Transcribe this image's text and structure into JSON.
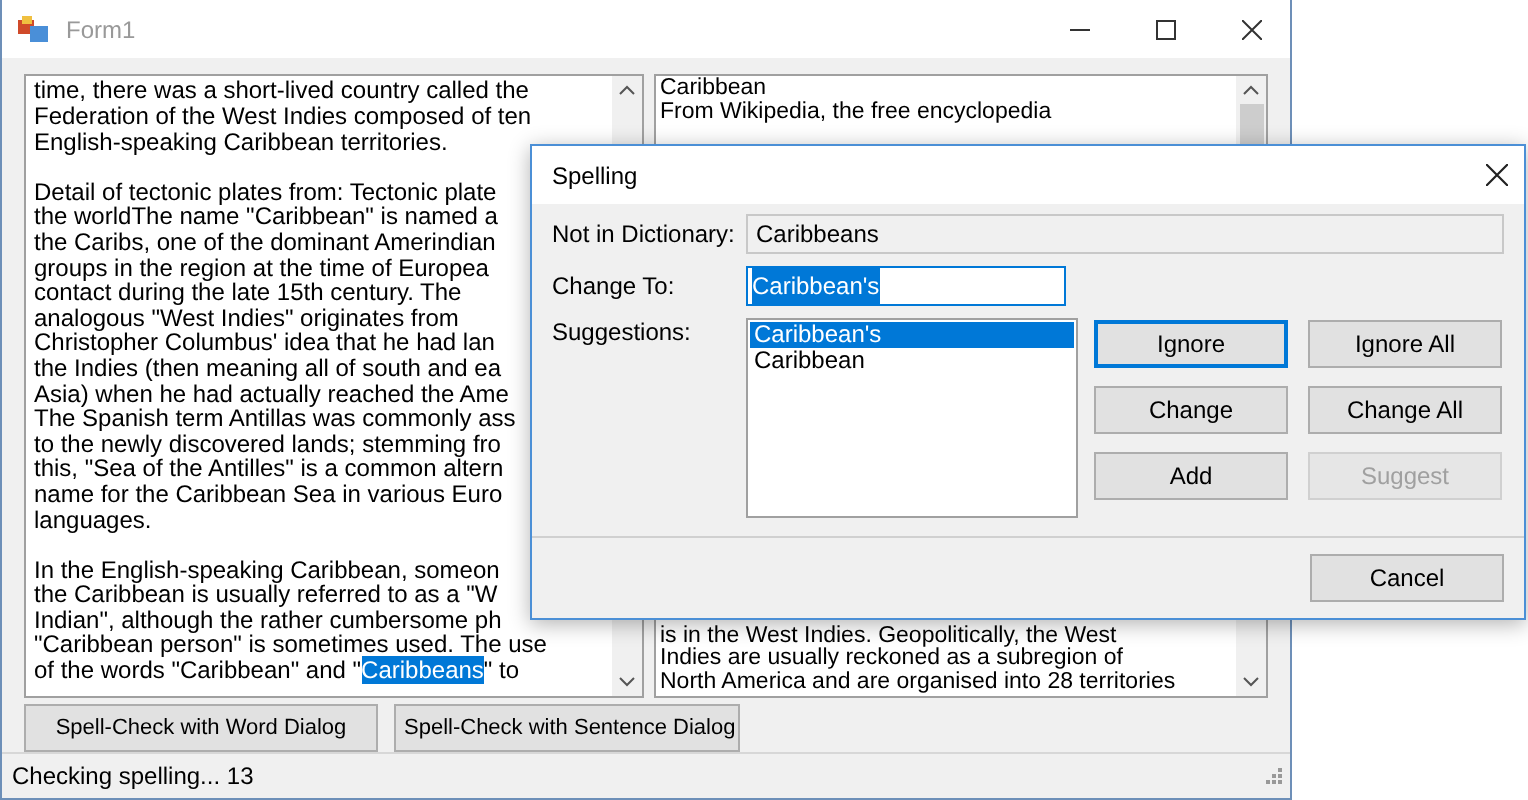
{
  "window": {
    "title": "Form1"
  },
  "left_text": {
    "paragraphs": [
      {
        "lines": [
          "time, there was a short-lived country called the",
          "Federation of the West Indies composed of ten",
          "English-speaking Caribbean territories."
        ]
      },
      {
        "lines": [
          "Detail of tectonic plates from: Tectonic plate",
          "the worldThe name \"Caribbean\" is named a",
          "the Caribs, one of the dominant Amerindian",
          "groups in the region at the time of Europea",
          "contact during the late 15th century. The",
          "analogous \"West Indies\" originates from",
          "Christopher Columbus' idea that he had lan",
          "the Indies (then meaning all of south and ea",
          "Asia) when he had actually reached the Ame",
          "The Spanish term Antillas was commonly ass",
          "to the newly discovered lands; stemming fro",
          "this, \"Sea of the Antilles\" is a common altern",
          "name for the Caribbean Sea in various Euro",
          "languages."
        ]
      },
      {
        "lines": [
          "In the English-speaking Caribbean, someon",
          "the Caribbean is usually referred to as a \"W",
          "Indian\", although the rather cumbersome ph",
          "\"Caribbean person\" is sometimes used. The use",
          [
            {
              "text": "of the words \"Caribbean\" and \"",
              "selected": false
            },
            {
              "text": "Caribbeans",
              "selected": true
            },
            {
              "text": "\" to",
              "selected": false
            }
          ]
        ]
      }
    ]
  },
  "right_text": {
    "top_lines": [
      "Caribbean",
      "From Wikipedia, the free encyclopedia"
    ],
    "bottom_lines": [
      "is in the West Indies. Geopolitically, the West",
      "Indies are usually reckoned as a subregion of",
      "North America and are organised into 28 territories"
    ]
  },
  "buttons": [
    {
      "label": "Spell-Check with Word Dialog"
    },
    {
      "label": "Spell-Check with Sentence Dialog"
    }
  ],
  "status_bar": {
    "text": "Checking spelling... 13"
  },
  "dialog": {
    "title": "Spelling",
    "not_in_dictionary": {
      "label": "Not in Dictionary:",
      "value": "Caribbeans"
    },
    "change_to": {
      "label": "Change To:",
      "value": "Caribbean's",
      "selected": true
    },
    "suggestions": {
      "label": "Suggestions:",
      "items": [
        {
          "text": "Caribbean's",
          "selected": true
        },
        {
          "text": "Caribbean",
          "selected": false
        }
      ]
    },
    "buttons": [
      {
        "label": "Ignore",
        "default": true,
        "disabled": false
      },
      {
        "label": "Ignore All",
        "default": false,
        "disabled": false
      },
      {
        "label": "Change",
        "default": false,
        "disabled": false
      },
      {
        "label": "Change All",
        "default": false,
        "disabled": false
      },
      {
        "label": "Add",
        "default": false,
        "disabled": false
      },
      {
        "label": "Suggest",
        "default": false,
        "disabled": true
      }
    ],
    "cancel": {
      "label": "Cancel"
    }
  }
}
